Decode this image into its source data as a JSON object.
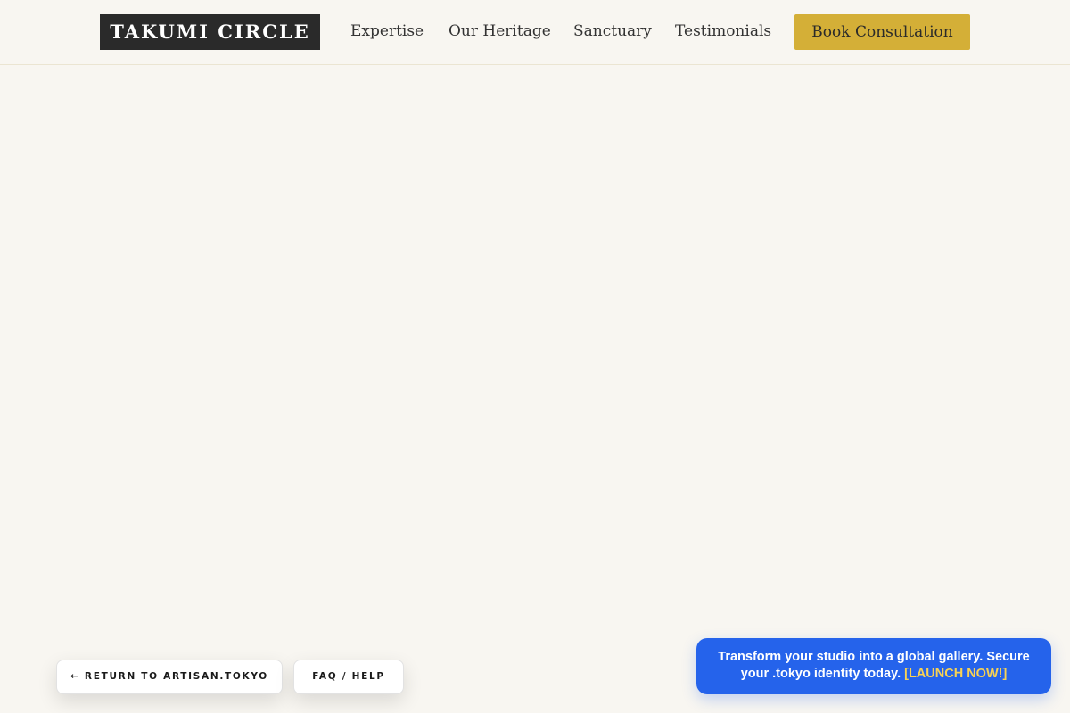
{
  "header": {
    "logo": "TAKUMI CIRCLE",
    "nav": [
      {
        "label": "Expertise"
      },
      {
        "label": "Our Heritage"
      },
      {
        "label": "Sanctuary"
      },
      {
        "label": "Testimonials"
      }
    ],
    "cta_label": "Book Consultation"
  },
  "footer_buttons": {
    "return_label": "← RETURN TO ARTISAN.TOKYO",
    "faq_label": "FAQ / HELP"
  },
  "promo": {
    "text": "Transform your studio into a global gallery. Secure your .tokyo identity today.",
    "link_label": "[LAUNCH NOW!]"
  },
  "colors": {
    "background": "#f8f6f1",
    "logo_bg": "#2a2a2a",
    "accent_gold": "#d4af37",
    "promo_blue": "#2563eb",
    "promo_link": "#f7d254"
  }
}
